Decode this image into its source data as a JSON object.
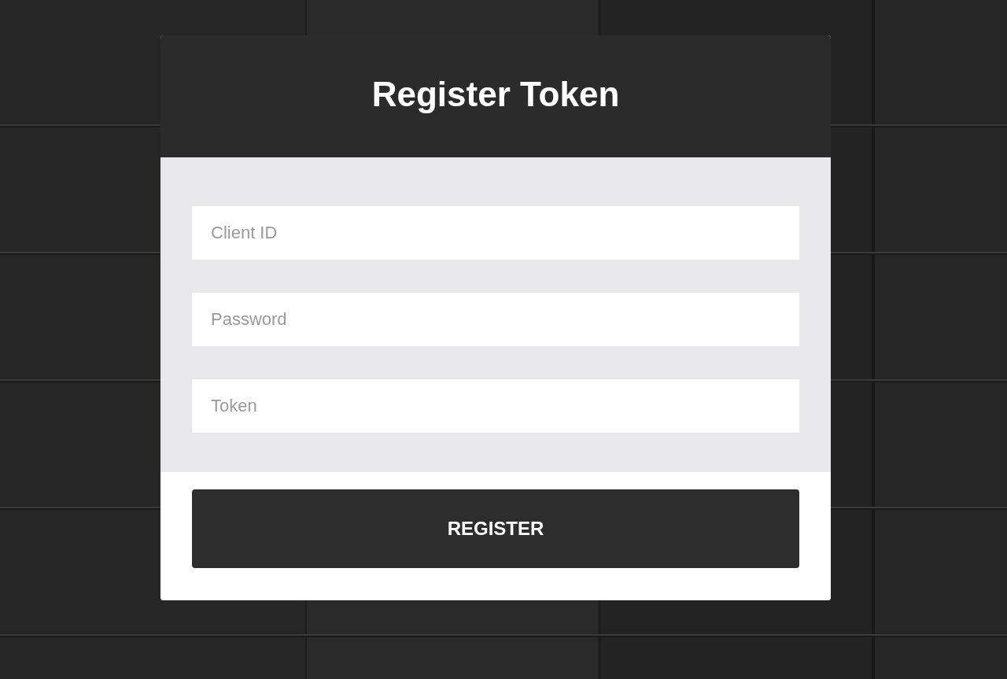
{
  "title": "Register Token",
  "fields": [
    {
      "placeholder": "Client ID"
    },
    {
      "placeholder": "Password"
    },
    {
      "placeholder": "Token"
    }
  ],
  "button": "REGISTER"
}
